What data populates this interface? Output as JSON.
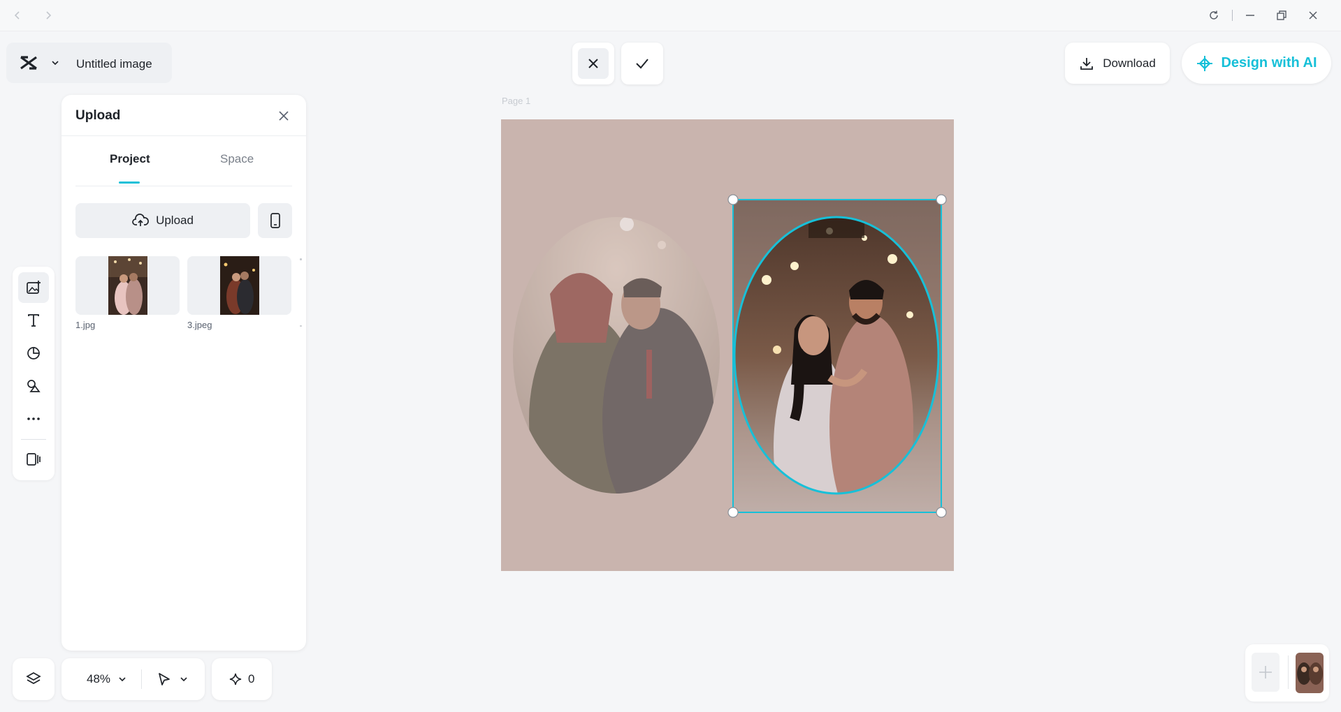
{
  "window": {
    "back_icon": "chevron-left-icon",
    "forward_icon": "chevron-right-icon",
    "controls": [
      "refresh-icon",
      "minimize-icon",
      "restore-icon",
      "close-icon"
    ]
  },
  "header": {
    "project_title": "Untitled image",
    "download_label": "Download",
    "design_ai_label": "Design with AI",
    "accent_color": "#17c0d8"
  },
  "crop_actions": {
    "cancel_icon": "close-icon",
    "confirm_icon": "check-icon"
  },
  "upload_panel": {
    "title": "Upload",
    "tabs": [
      {
        "label": "Project",
        "active": true
      },
      {
        "label": "Space",
        "active": false
      }
    ],
    "upload_button_label": "Upload",
    "files": [
      {
        "name": "1.jpg"
      },
      {
        "name": "3.jpeg"
      }
    ]
  },
  "sidebar": {
    "tools": [
      "add-image-icon",
      "text-icon",
      "shapes-icon",
      "elements-icon",
      "more-icon",
      "templates-icon"
    ]
  },
  "canvas": {
    "page_label": "Page 1",
    "background_color": "#c9b4ae"
  },
  "bottom_bar": {
    "zoom": "48%",
    "ai_credits": "0"
  }
}
